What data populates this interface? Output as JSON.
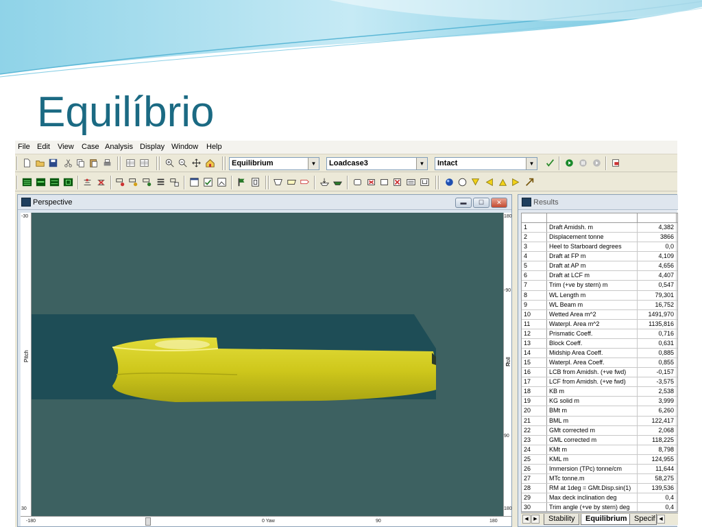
{
  "slide": {
    "title": "Equilíbrio"
  },
  "menu": [
    "File",
    "Edit",
    "View",
    "Case",
    "Analysis",
    "Display",
    "Window",
    "Help"
  ],
  "toolbar": {
    "analysis_type": "Equilibrium",
    "loadcase": "Loadcase3",
    "condition": "Intact"
  },
  "perspective": {
    "title": "Perspective",
    "left_ruler": {
      "top": "-30",
      "bottom": "30",
      "label": "Pitch"
    },
    "right_ruler": {
      "top": "180",
      "upper": "-90",
      "middle": "0",
      "lower": "90",
      "bottom": "180",
      "label": "Roll"
    },
    "bottom_ruler": {
      "left": "-180",
      "center": "0 Yaw",
      "right_mid": "90",
      "right": "180"
    },
    "colors": {
      "background": "#3d6161",
      "hull": "#d4cf1e",
      "waterplane": "#1e4d56"
    }
  },
  "results": {
    "title": "Results",
    "rows": [
      {
        "n": "1",
        "label": "Draft Amidsh. m",
        "value": "4,382"
      },
      {
        "n": "2",
        "label": "Displacement tonne",
        "value": "3866"
      },
      {
        "n": "3",
        "label": "Heel to Starboard degrees",
        "value": "0,0"
      },
      {
        "n": "4",
        "label": "Draft at FP m",
        "value": "4,109"
      },
      {
        "n": "5",
        "label": "Draft at AP m",
        "value": "4,656"
      },
      {
        "n": "6",
        "label": "Draft at LCF m",
        "value": "4,407"
      },
      {
        "n": "7",
        "label": "Trim (+ve by stern) m",
        "value": "0,547"
      },
      {
        "n": "8",
        "label": "WL Length m",
        "value": "79,301"
      },
      {
        "n": "9",
        "label": "WL Beam m",
        "value": "16,752"
      },
      {
        "n": "10",
        "label": "Wetted Area m^2",
        "value": "1491,970"
      },
      {
        "n": "11",
        "label": "Waterpl. Area m^2",
        "value": "1135,816"
      },
      {
        "n": "12",
        "label": "Prismatic Coeff.",
        "value": "0,716"
      },
      {
        "n": "13",
        "label": "Block Coeff.",
        "value": "0,631"
      },
      {
        "n": "14",
        "label": "Midship Area Coeff.",
        "value": "0,885"
      },
      {
        "n": "15",
        "label": "Waterpl. Area Coeff.",
        "value": "0,855"
      },
      {
        "n": "16",
        "label": "LCB from Amidsh. (+ve fwd)",
        "value": "-0,157"
      },
      {
        "n": "17",
        "label": "LCF from Amidsh. (+ve fwd)",
        "value": "-3,575"
      },
      {
        "n": "18",
        "label": "KB m",
        "value": "2,538"
      },
      {
        "n": "19",
        "label": "KG solid m",
        "value": "3,999"
      },
      {
        "n": "20",
        "label": "BMt m",
        "value": "6,260"
      },
      {
        "n": "21",
        "label": "BML m",
        "value": "122,417"
      },
      {
        "n": "22",
        "label": "GMt corrected m",
        "value": "2,068"
      },
      {
        "n": "23",
        "label": "GML corrected m",
        "value": "118,225"
      },
      {
        "n": "24",
        "label": "KMt m",
        "value": "8,798"
      },
      {
        "n": "25",
        "label": "KML m",
        "value": "124,955"
      },
      {
        "n": "26",
        "label": "Immersion (TPc) tonne/cm",
        "value": "11,644"
      },
      {
        "n": "27",
        "label": "MTc tonne.m",
        "value": "58,275"
      },
      {
        "n": "28",
        "label": "RM at 1deg = GMt.Disp.sin(1)",
        "value": "139,536"
      },
      {
        "n": "29",
        "label": "Max deck inclination deg",
        "value": "0,4"
      },
      {
        "n": "30",
        "label": "Trim angle (+ve by stern) deg",
        "value": "0,4"
      }
    ],
    "tabs": [
      "Stability",
      "Equilibrium",
      "Specif"
    ]
  }
}
